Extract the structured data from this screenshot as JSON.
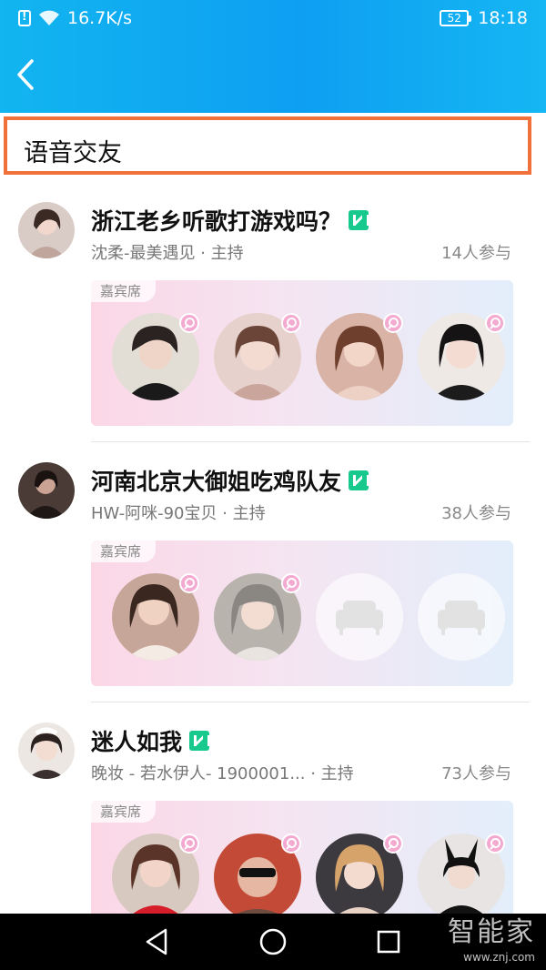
{
  "status_bar": {
    "speed": "16.7K/s",
    "battery": "52",
    "time": "18:18"
  },
  "header": {
    "title": "语音交友",
    "back_icon": "chevron-left-icon"
  },
  "rooms": [
    {
      "title": "浙江老乡听歌打游戏吗？",
      "host": "沈柔-最美遇见",
      "host_suffix": "· 主持",
      "count": "14人参与",
      "guest_label": "嘉宾席"
    },
    {
      "title": "河南北京大御姐吃鸡队友",
      "host": "HW-阿咪-90宝贝",
      "host_suffix": "· 主持",
      "count": "38人参与",
      "guest_label": "嘉宾席"
    },
    {
      "title": "迷人如我",
      "host": "晚妆 - 若水伊人- 1900001...",
      "host_suffix": "· 主持",
      "count": "73人参与",
      "guest_label": "嘉宾席"
    }
  ],
  "watermark": {
    "brand": "智能家",
    "url": "www.znj.com"
  },
  "colors": {
    "header_gradient_start": "#12b5f0",
    "header_gradient_end": "#15b6f3",
    "highlight_border": "#f2703a",
    "live_badge": "#17c98d",
    "female_badge": "#f3a9d0"
  }
}
